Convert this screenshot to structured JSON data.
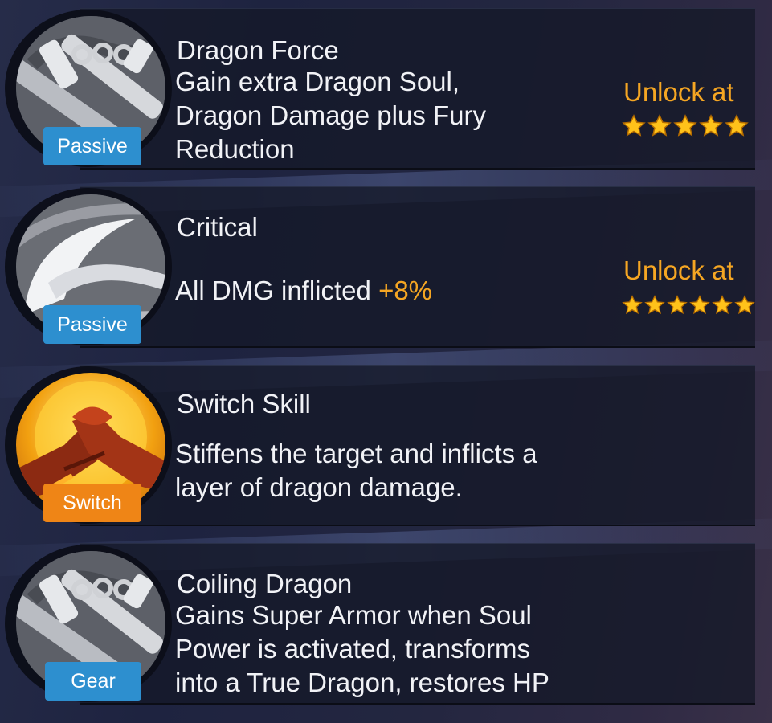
{
  "colors": {
    "accent": "#f5a623",
    "passive": "#2d8fcf",
    "switch": "#ef8516"
  },
  "skills": [
    {
      "name": "Dragon Force",
      "icon": "nunchaku-icon",
      "tag": "Passive",
      "desc_lines": [
        "Gain extra Dragon Soul,",
        "Dragon Damage plus Fury",
        "Reduction"
      ],
      "unlock": "Unlock at",
      "stars": 5
    },
    {
      "name": "Critical",
      "icon": "slash-icon",
      "tag": "Passive",
      "desc_text": "All DMG inflicted",
      "desc_value": "+8%",
      "unlock": "Unlock at",
      "stars": 6
    },
    {
      "name": "Switch Skill",
      "icon": "handshake-icon",
      "tag": "Switch",
      "desc_lines": [
        "Stiffens the target and inflicts a",
        "layer of dragon damage."
      ]
    },
    {
      "name": "Coiling Dragon",
      "icon": "nunchaku-icon",
      "tag": "Gear",
      "desc_lines": [
        "Gains Super Armor when Soul",
        "Power is activated, transforms",
        "into a True Dragon, restores HP"
      ]
    }
  ]
}
